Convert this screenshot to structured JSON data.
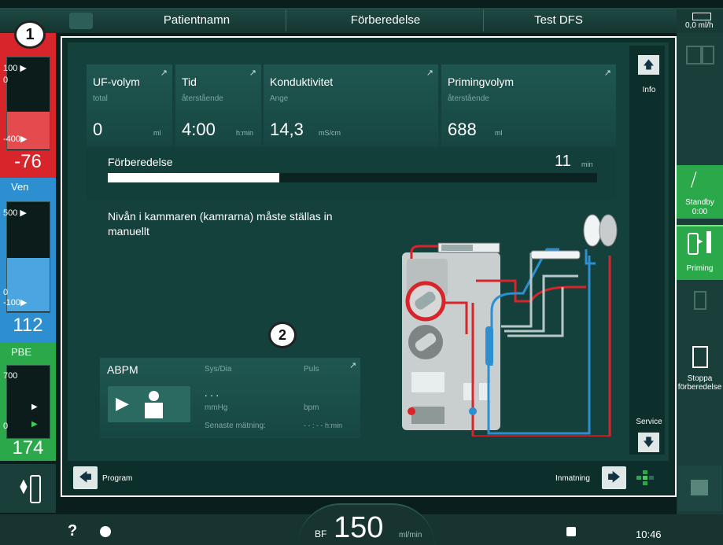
{
  "header": {
    "patient_label": "Patientnamn",
    "phase_label": "Förberedelse",
    "program_label": "Test DFS",
    "status_readout": "0,0  ml/h"
  },
  "left_panel": {
    "arterial": {
      "scale_top": "100 ▶",
      "scale_zero": "0",
      "scale_bottom": "-400▶",
      "value": "-76"
    },
    "venous": {
      "label": "Ven",
      "scale_top": "500 ▶",
      "scale_zero": "0",
      "scale_bottom": "-100▶",
      "value": "112"
    },
    "pbe": {
      "label": "PBE",
      "scale_top": "700",
      "scale_bottom": "0",
      "value": "174"
    }
  },
  "cards": [
    {
      "title": "UF-volym",
      "sub": "total",
      "value": "0",
      "unit": "ml"
    },
    {
      "title": "Tid",
      "sub": "återstående",
      "value": "4:00",
      "unit": "h:min"
    },
    {
      "title": "Konduktivitet",
      "sub": "Ange",
      "value": "14,3",
      "unit": "mS/cm"
    },
    {
      "title": "Primingvolym",
      "sub": "återstående",
      "value": "688",
      "unit": "ml"
    }
  ],
  "progress": {
    "label": "Förberedelse",
    "value": "11",
    "unit": "min",
    "fraction": 0.35
  },
  "message": "Nivån i kammaren (kamrarna) måste ställas in manuellt",
  "abpm": {
    "title": "ABPM",
    "sys_dia_label": "Sys/Dia",
    "pulse_label": "Puls",
    "sys_dia_value": ". . .",
    "unit_mmhg": "mmHg",
    "unit_bpm": "bpm",
    "last_measurement_label": "Senaste mätning:",
    "last_measurement_value": "- - : - - h:min"
  },
  "side_buttons": {
    "info": "Info",
    "service": "Service"
  },
  "bottom_nav": {
    "program": "Program",
    "inmatning": "Inmatning"
  },
  "right_panel": {
    "standby_label": "Standby",
    "standby_time": "0:00",
    "priming_label": "Priming",
    "stop_label": "Stoppa förberedelse"
  },
  "footer": {
    "bf_label": "BF",
    "bf_value": "150",
    "bf_unit": "ml/min",
    "clock": "10:46",
    "help": "?"
  },
  "callouts": {
    "one": "1",
    "two": "2"
  },
  "colors": {
    "accent_green": "#2aa84a",
    "arterial_red": "#d8252b",
    "venous_blue": "#2e8fd0",
    "panel": "#14413c"
  }
}
